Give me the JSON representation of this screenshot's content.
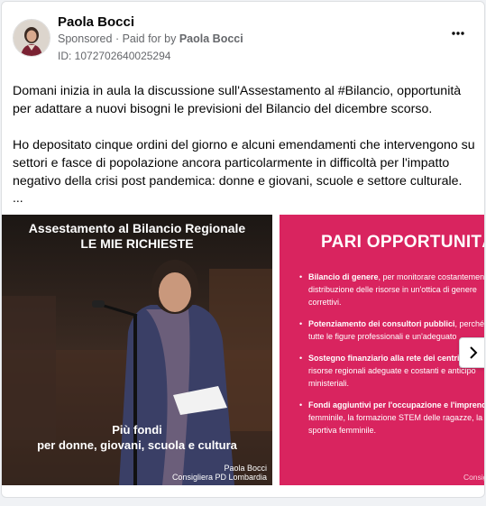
{
  "post": {
    "author": "Paola Bocci",
    "sponsored": "Sponsored",
    "paid_for_prefix": "Paid for by",
    "paid_for_by": "Paola Bocci",
    "id_label": "ID: 1072702640025294",
    "paragraphs": [
      "Domani inizia in aula la discussione sull'Assestamento al #Bilancio, opportunità per adattare a nuovi bisogni le previsioni del Bilancio del dicembre scorso.",
      "Ho depositato cinque ordini del giorno e alcuni emendamenti che intervengono su settori e fasce di popolazione ancora particolarmente in difficoltà per l'impatto negativo della crisi post pandemica: donne e giovani, scuole e settore culturale."
    ],
    "ellipsis": "..."
  },
  "slide1": {
    "title_line1": "Assestamento al Bilancio Regionale",
    "title_line2": "LE MIE RICHIESTE",
    "caption_line1": "Più fondi",
    "caption_line2": "per donne, giovani, scuola e cultura",
    "sign_name": "Paola Bocci",
    "sign_role": "Consigliera PD Lombardia"
  },
  "slide2": {
    "title": "PARI OPPORTUNITÀ",
    "items": [
      {
        "bold": "Bilancio di genere",
        "rest": ", per monitorare costantemente la",
        "l2": "distribuzione delle risorse in un'ottica di genere",
        "l3": "correttivi."
      },
      {
        "bold": "Potenziamento dei consultori pubblici",
        "rest": ", perché",
        "l2": "tutte le figure professionali e un'adeguato",
        "l3": ""
      },
      {
        "bold": "Sostegno finanziario alla rete dei centri antiviolenza",
        "rest": "",
        "l2": "risorse regionali adeguate e costanti e anticipo",
        "l3": "ministeriali."
      },
      {
        "bold": "Fondi aggiuntivi per l'occupazione e l'imprenditoria",
        "rest": "",
        "l2": "femminile, la formazione STEM delle ragazze, la",
        "l3": "sportiva femminile."
      }
    ],
    "footer": "Consiglio"
  },
  "colors": {
    "slide2_bg": "#d9245f",
    "slide1_bg": "#2a2320"
  },
  "icons": {
    "more": "more-horizontal-icon",
    "next": "chevron-right-icon"
  }
}
